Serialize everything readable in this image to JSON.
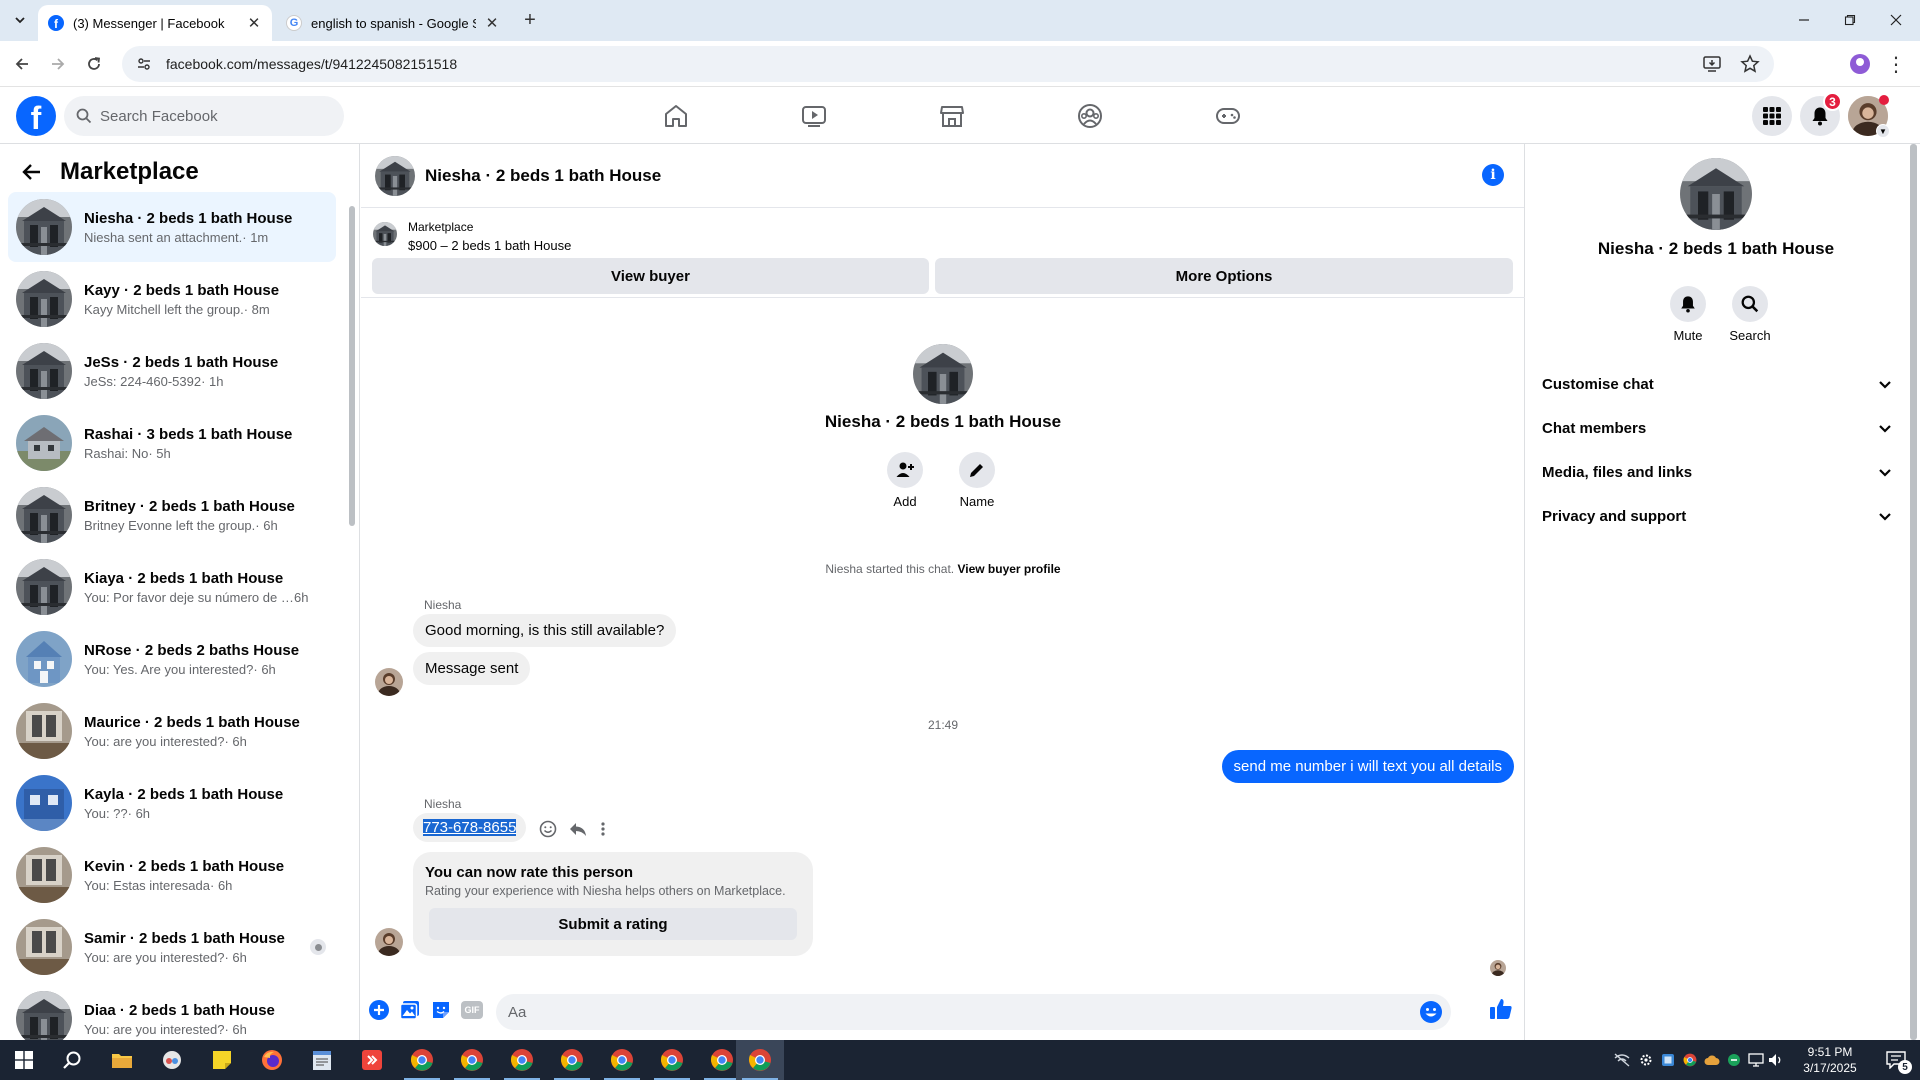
{
  "browser": {
    "tabs": [
      {
        "title": "(3) Messenger | Facebook",
        "active": true
      },
      {
        "title": "english to spanish - Google Search",
        "active": false
      }
    ],
    "url": "facebook.com/messages/t/9412245082151518"
  },
  "fb": {
    "search_placeholder": "Search Facebook",
    "notification_count": "3"
  },
  "left": {
    "title": "Marketplace",
    "conversations": [
      {
        "name": "Niesha · 2 beds 1 bath House",
        "preview": "Niesha sent an attachment.",
        "time": " · 1m",
        "active": true
      },
      {
        "name": "Kayy · 2 beds 1 bath House",
        "preview": "Kayy Mitchell left the group.",
        "time": " · 8m"
      },
      {
        "name": "JeSs · 2 beds 1 bath House",
        "preview": "JeSs: 224-460-5392",
        "time": " · 1h"
      },
      {
        "name": "Rashai · 3 beds 1 bath House",
        "preview": "Rashai: No",
        "time": " · 5h"
      },
      {
        "name": "Britney · 2 beds 1 bath House",
        "preview": "Britney Evonne left the group.",
        "time": " · 6h"
      },
      {
        "name": "Kiaya · 2 beds 1 bath House",
        "preview": "You: Por favor deje su número de c...",
        "time": "  6h"
      },
      {
        "name": "NRose · 2 beds 2 baths House",
        "preview": "You: Yes. Are you interested?",
        "time": " · 6h"
      },
      {
        "name": "Maurice · 2 beds 1 bath House",
        "preview": "You: are you interested?",
        "time": " · 6h"
      },
      {
        "name": "Kayla · 2 beds 1 bath House",
        "preview": "You: ??",
        "time": " · 6h"
      },
      {
        "name": "Kevin · 2 beds 1 bath House",
        "preview": "You: Estas interesada",
        "time": " · 6h"
      },
      {
        "name": "Samir · 2 beds 1 bath House",
        "preview": "You: are you interested?",
        "time": " · 6h",
        "muted": true
      },
      {
        "name": "Diaa · 2 beds 1 bath House",
        "preview": "You: are you interested?",
        "time": " · 6h"
      }
    ]
  },
  "chat": {
    "title": "Niesha · 2 beds 1 bath House",
    "banner": {
      "label": "Marketplace",
      "listing": "$900 – 2 beds 1 bath House",
      "view_buyer": "View buyer",
      "more_options": "More Options"
    },
    "intro": {
      "name": "Niesha · 2 beds 1 bath House",
      "add_label": "Add",
      "name_label": "Name",
      "started_text": "Niesha started this chat.",
      "view_profile": "View buyer profile"
    },
    "messages": {
      "sender1": "Niesha",
      "m1": "Good morning, is this still available?",
      "m2": "Message sent",
      "timestamp": "21:49",
      "out1": "send me number i will text you all details",
      "sender2": "Niesha",
      "phone": "773-678-8655"
    },
    "rating": {
      "title": "You can now rate this person",
      "subtitle": "Rating your experience with Niesha helps others on Marketplace.",
      "button": "Submit a rating"
    },
    "composer_placeholder": "Aa"
  },
  "right": {
    "name": "Niesha · 2 beds 1 bath House",
    "mute_label": "Mute",
    "search_label": "Search",
    "sections": [
      "Customise chat",
      "Chat members",
      "Media, files and links",
      "Privacy and support"
    ]
  },
  "taskbar": {
    "time": "9:51 PM",
    "date": "3/17/2025",
    "notifications": "5"
  },
  "colors": {
    "fb_blue": "#0866ff",
    "active_row": "#ebf5ff",
    "badge_red": "#e41e3f",
    "taskbar": "#1b2433"
  }
}
